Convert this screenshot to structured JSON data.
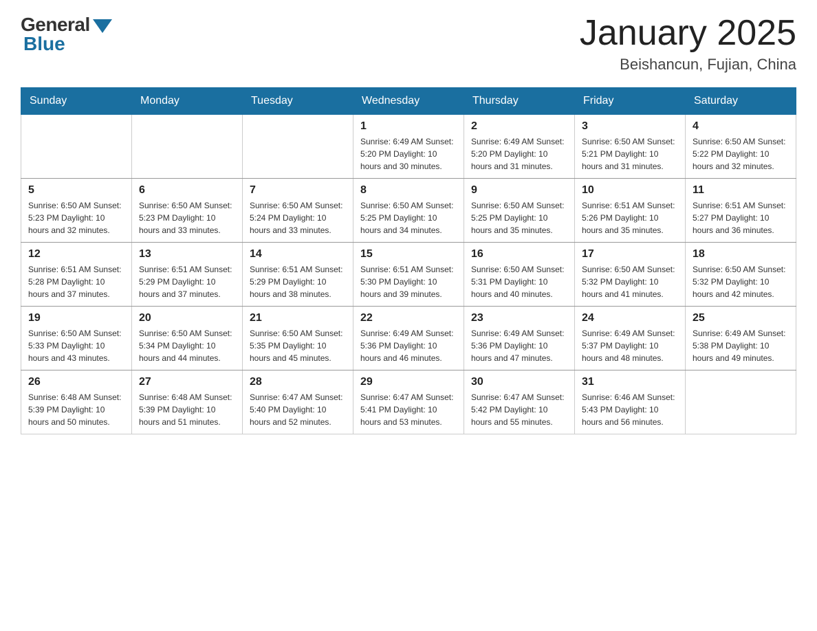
{
  "header": {
    "logo": {
      "general": "General",
      "blue": "Blue"
    },
    "title": "January 2025",
    "location": "Beishancun, Fujian, China"
  },
  "calendar": {
    "days_of_week": [
      "Sunday",
      "Monday",
      "Tuesday",
      "Wednesday",
      "Thursday",
      "Friday",
      "Saturday"
    ],
    "weeks": [
      [
        {
          "day": "",
          "info": ""
        },
        {
          "day": "",
          "info": ""
        },
        {
          "day": "",
          "info": ""
        },
        {
          "day": "1",
          "info": "Sunrise: 6:49 AM\nSunset: 5:20 PM\nDaylight: 10 hours\nand 30 minutes."
        },
        {
          "day": "2",
          "info": "Sunrise: 6:49 AM\nSunset: 5:20 PM\nDaylight: 10 hours\nand 31 minutes."
        },
        {
          "day": "3",
          "info": "Sunrise: 6:50 AM\nSunset: 5:21 PM\nDaylight: 10 hours\nand 31 minutes."
        },
        {
          "day": "4",
          "info": "Sunrise: 6:50 AM\nSunset: 5:22 PM\nDaylight: 10 hours\nand 32 minutes."
        }
      ],
      [
        {
          "day": "5",
          "info": "Sunrise: 6:50 AM\nSunset: 5:23 PM\nDaylight: 10 hours\nand 32 minutes."
        },
        {
          "day": "6",
          "info": "Sunrise: 6:50 AM\nSunset: 5:23 PM\nDaylight: 10 hours\nand 33 minutes."
        },
        {
          "day": "7",
          "info": "Sunrise: 6:50 AM\nSunset: 5:24 PM\nDaylight: 10 hours\nand 33 minutes."
        },
        {
          "day": "8",
          "info": "Sunrise: 6:50 AM\nSunset: 5:25 PM\nDaylight: 10 hours\nand 34 minutes."
        },
        {
          "day": "9",
          "info": "Sunrise: 6:50 AM\nSunset: 5:25 PM\nDaylight: 10 hours\nand 35 minutes."
        },
        {
          "day": "10",
          "info": "Sunrise: 6:51 AM\nSunset: 5:26 PM\nDaylight: 10 hours\nand 35 minutes."
        },
        {
          "day": "11",
          "info": "Sunrise: 6:51 AM\nSunset: 5:27 PM\nDaylight: 10 hours\nand 36 minutes."
        }
      ],
      [
        {
          "day": "12",
          "info": "Sunrise: 6:51 AM\nSunset: 5:28 PM\nDaylight: 10 hours\nand 37 minutes."
        },
        {
          "day": "13",
          "info": "Sunrise: 6:51 AM\nSunset: 5:29 PM\nDaylight: 10 hours\nand 37 minutes."
        },
        {
          "day": "14",
          "info": "Sunrise: 6:51 AM\nSunset: 5:29 PM\nDaylight: 10 hours\nand 38 minutes."
        },
        {
          "day": "15",
          "info": "Sunrise: 6:51 AM\nSunset: 5:30 PM\nDaylight: 10 hours\nand 39 minutes."
        },
        {
          "day": "16",
          "info": "Sunrise: 6:50 AM\nSunset: 5:31 PM\nDaylight: 10 hours\nand 40 minutes."
        },
        {
          "day": "17",
          "info": "Sunrise: 6:50 AM\nSunset: 5:32 PM\nDaylight: 10 hours\nand 41 minutes."
        },
        {
          "day": "18",
          "info": "Sunrise: 6:50 AM\nSunset: 5:32 PM\nDaylight: 10 hours\nand 42 minutes."
        }
      ],
      [
        {
          "day": "19",
          "info": "Sunrise: 6:50 AM\nSunset: 5:33 PM\nDaylight: 10 hours\nand 43 minutes."
        },
        {
          "day": "20",
          "info": "Sunrise: 6:50 AM\nSunset: 5:34 PM\nDaylight: 10 hours\nand 44 minutes."
        },
        {
          "day": "21",
          "info": "Sunrise: 6:50 AM\nSunset: 5:35 PM\nDaylight: 10 hours\nand 45 minutes."
        },
        {
          "day": "22",
          "info": "Sunrise: 6:49 AM\nSunset: 5:36 PM\nDaylight: 10 hours\nand 46 minutes."
        },
        {
          "day": "23",
          "info": "Sunrise: 6:49 AM\nSunset: 5:36 PM\nDaylight: 10 hours\nand 47 minutes."
        },
        {
          "day": "24",
          "info": "Sunrise: 6:49 AM\nSunset: 5:37 PM\nDaylight: 10 hours\nand 48 minutes."
        },
        {
          "day": "25",
          "info": "Sunrise: 6:49 AM\nSunset: 5:38 PM\nDaylight: 10 hours\nand 49 minutes."
        }
      ],
      [
        {
          "day": "26",
          "info": "Sunrise: 6:48 AM\nSunset: 5:39 PM\nDaylight: 10 hours\nand 50 minutes."
        },
        {
          "day": "27",
          "info": "Sunrise: 6:48 AM\nSunset: 5:39 PM\nDaylight: 10 hours\nand 51 minutes."
        },
        {
          "day": "28",
          "info": "Sunrise: 6:47 AM\nSunset: 5:40 PM\nDaylight: 10 hours\nand 52 minutes."
        },
        {
          "day": "29",
          "info": "Sunrise: 6:47 AM\nSunset: 5:41 PM\nDaylight: 10 hours\nand 53 minutes."
        },
        {
          "day": "30",
          "info": "Sunrise: 6:47 AM\nSunset: 5:42 PM\nDaylight: 10 hours\nand 55 minutes."
        },
        {
          "day": "31",
          "info": "Sunrise: 6:46 AM\nSunset: 5:43 PM\nDaylight: 10 hours\nand 56 minutes."
        },
        {
          "day": "",
          "info": ""
        }
      ]
    ]
  }
}
